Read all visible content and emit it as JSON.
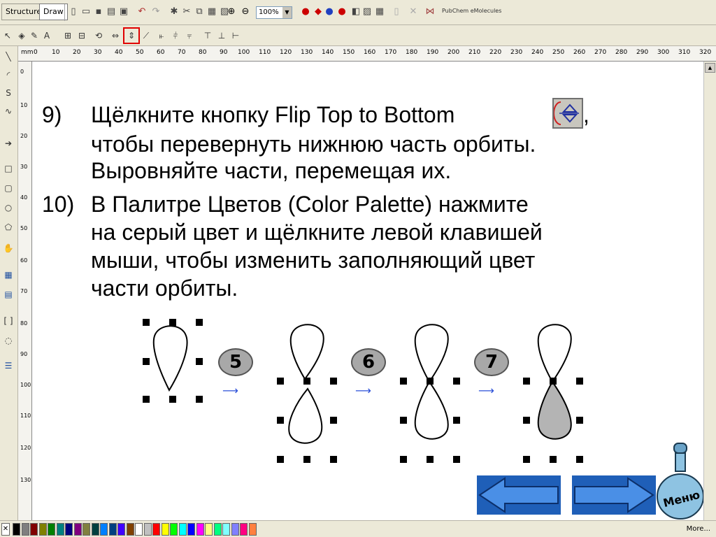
{
  "toolbar": {
    "tab_structure": "Structure",
    "tab_draw": "Draw",
    "zoom_value": "100%",
    "pubchem_label": "PubChem eMolecules"
  },
  "slide": {
    "item9": {
      "number": "9)",
      "line1": "Щёлкните кнопку Flip Top to Bottom",
      "line1_tail": ",",
      "line2": "чтобы перевернуть нижнюю часть орбиты.",
      "line3": "Выровняйте части, перемещая их."
    },
    "item10": {
      "number": "10)",
      "line1": "В Палитре Цветов (Color Palette) нажмите",
      "line2": "на серый цвет и щёлкните левой клавишей",
      "line3": "мыши, чтобы изменить заполняющий цвет",
      "line4": "части орбиты."
    },
    "steps": [
      "5",
      "6",
      "7"
    ]
  },
  "nav": {
    "menu_label": "Меню"
  },
  "palette": {
    "more_label": "More...",
    "colors": [
      "#000000",
      "#7f7f7f",
      "#800000",
      "#808000",
      "#008000",
      "#008080",
      "#000080",
      "#800080",
      "#808040",
      "#004040",
      "#0080ff",
      "#004080",
      "#4000ff",
      "#804000",
      "#ffffff",
      "#c0c0c0",
      "#ff0000",
      "#ffff00",
      "#00ff00",
      "#00ffff",
      "#0000ff",
      "#ff00ff",
      "#ffff80",
      "#00ff80",
      "#80ffff",
      "#8080ff",
      "#ff0080",
      "#ff8040"
    ]
  },
  "ruler": {
    "unit": "mm",
    "h_labels": [
      "0",
      "10",
      "20",
      "30",
      "40",
      "50",
      "60",
      "70",
      "80",
      "90",
      "100",
      "110",
      "120",
      "130",
      "140",
      "150",
      "160",
      "170",
      "180",
      "190",
      "200",
      "210",
      "220",
      "230",
      "240",
      "250",
      "260",
      "270",
      "280",
      "290",
      "300",
      "310",
      "320"
    ],
    "v_labels": [
      "0",
      "10",
      "20",
      "30",
      "40",
      "50",
      "60",
      "70",
      "80",
      "90",
      "100",
      "110",
      "120",
      "130"
    ]
  }
}
